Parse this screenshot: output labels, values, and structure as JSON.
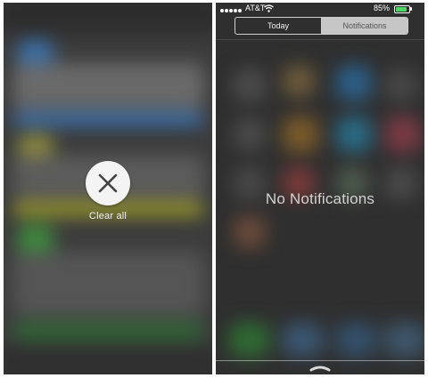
{
  "left": {
    "clear_label": "Clear all",
    "icons": {
      "clear_icon": "close-x-icon"
    }
  },
  "right": {
    "status_bar": {
      "carrier": "AT&T",
      "battery_text": "85%",
      "battery_level": 0.85
    },
    "tabs": [
      {
        "label": "Today",
        "selected": false
      },
      {
        "label": "Notifications",
        "selected": true
      }
    ],
    "empty_message": "No Notifications",
    "icons": {
      "signal": "signal-dots-icon",
      "wifi": "wifi-icon",
      "battery": "battery-icon",
      "grabber": "grabber-chevron-icon"
    }
  },
  "colors": {
    "battery_green": "#4cd964",
    "button_bg": "#f4f4f4",
    "panel_dark": "#3c3c3c"
  }
}
